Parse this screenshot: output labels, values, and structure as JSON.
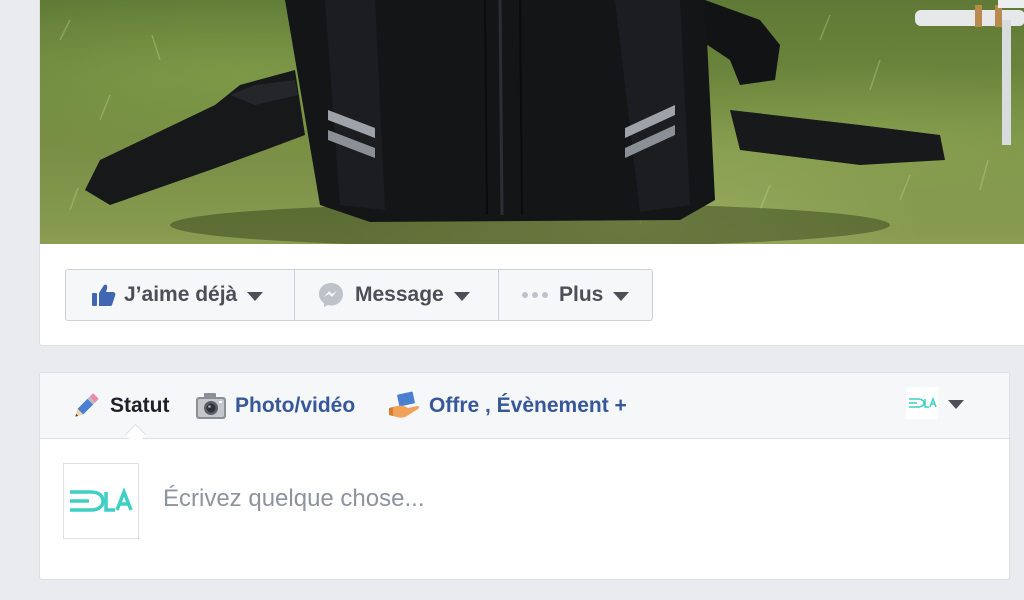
{
  "page_actions": {
    "like_label": "J’aime déjà",
    "message_label": "Message",
    "more_label": "Plus"
  },
  "composer": {
    "tabs": {
      "status": "Statut",
      "photo_video": "Photo/vidéo",
      "offer_event": "Offre , Évènement +"
    },
    "placeholder": "Écrivez quelque chose..."
  },
  "brand": {
    "logo_text": "DLA",
    "logo_color": "#3fcfc4"
  },
  "colors": {
    "link_blue": "#365899",
    "like_blue": "#4267b2",
    "text_dark": "#4b4f56",
    "placeholder_gray": "#8d949e"
  },
  "icons": {
    "like": "thumbs-up-icon",
    "message": "messenger-icon",
    "more": "ellipsis-icon",
    "status": "pencil-icon",
    "photo": "camera-icon",
    "offer": "hand-offer-icon",
    "dropdown": "caret-down-icon"
  }
}
